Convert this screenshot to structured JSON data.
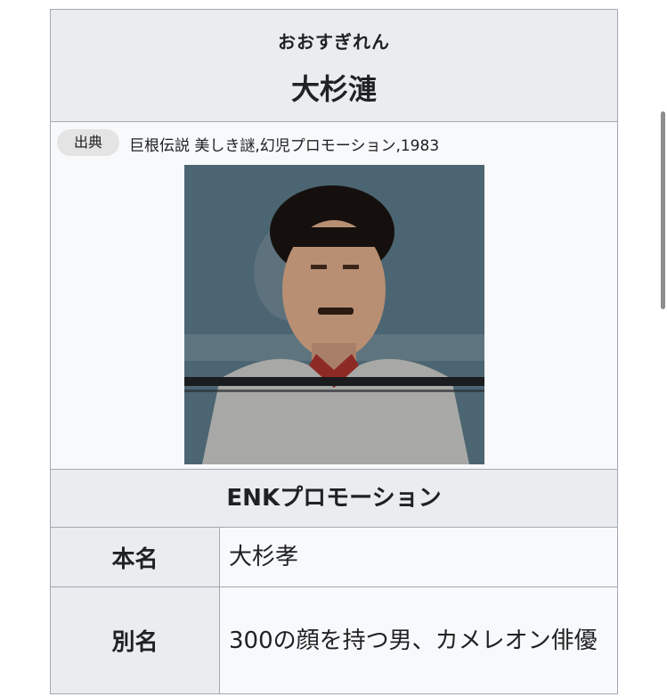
{
  "infobox": {
    "reading": "おおすぎれん",
    "name": "大杉漣",
    "source_badge": "出典",
    "source_text": "巨根伝説 美しき謎,幻児プロモーション,1983",
    "section_title": "ENKプロモーション",
    "rows": [
      {
        "label": "本名",
        "value": "大杉孝"
      },
      {
        "label": "別名",
        "value": "300の顔を持つ男、カメレオン俳優"
      }
    ]
  },
  "colors": {
    "header_bg": "#eaecf0",
    "cell_bg": "#f8f9fa",
    "border": "#a2a9b1"
  },
  "icons": [
    "portrait-photo"
  ]
}
